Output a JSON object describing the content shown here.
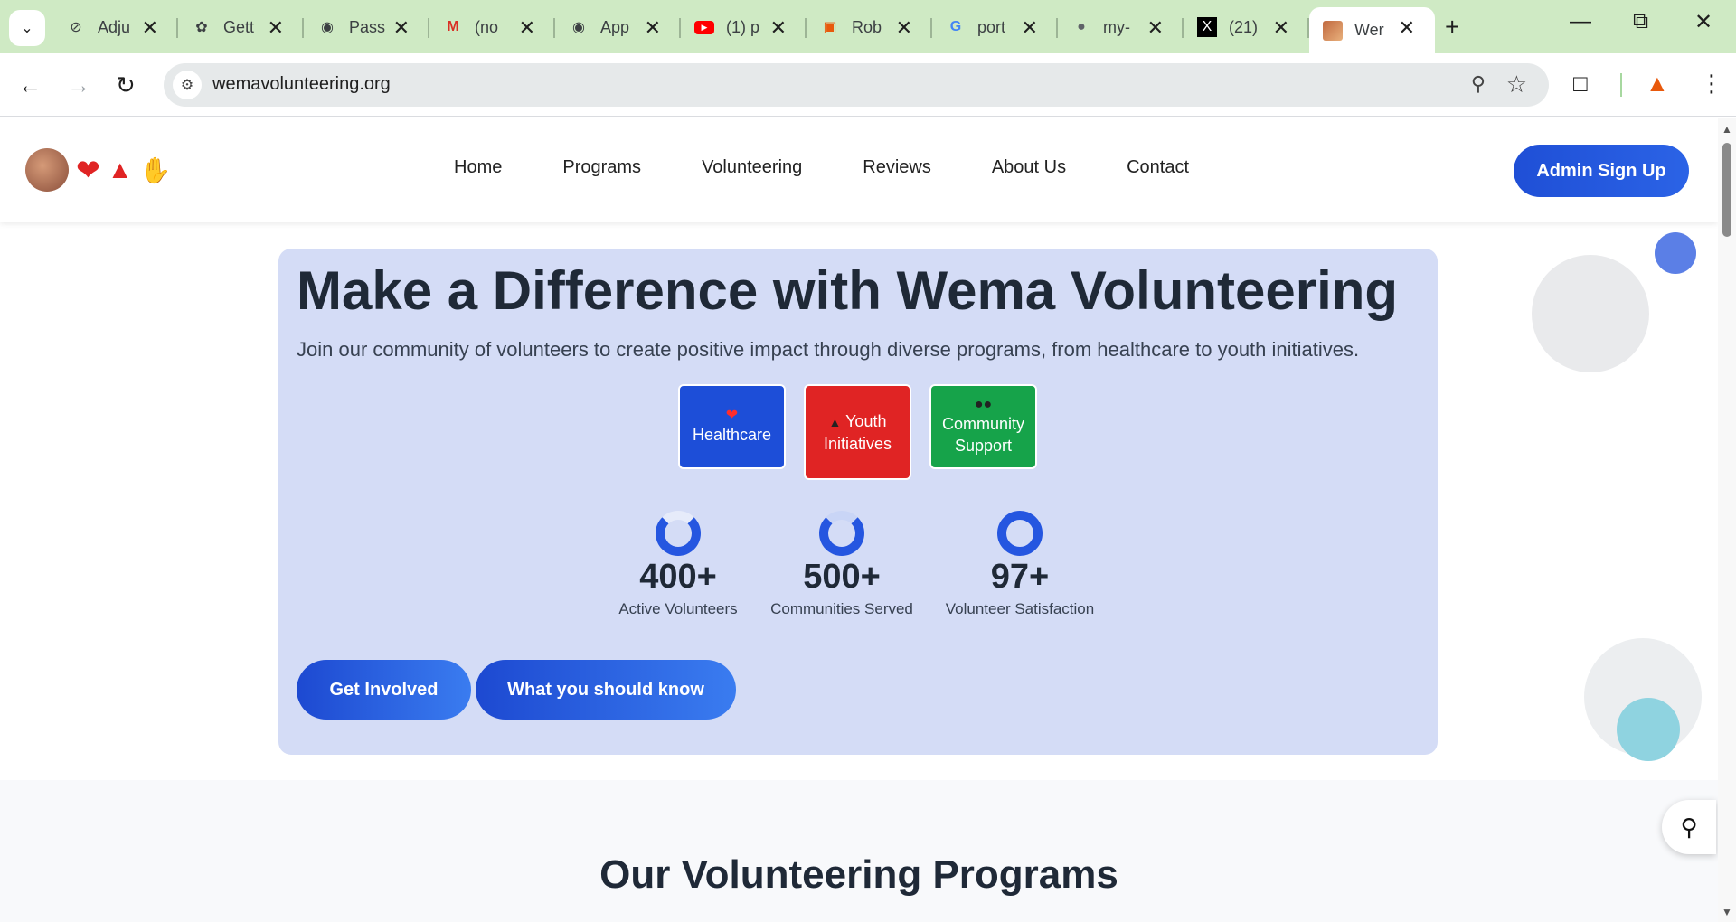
{
  "browser": {
    "tabs": [
      {
        "title": "Adju",
        "icon": "perplexity-icon"
      },
      {
        "title": "Gett",
        "icon": "openai-icon"
      },
      {
        "title": "Pass",
        "icon": "github-icon"
      },
      {
        "title": "(no",
        "icon": "gmail-icon"
      },
      {
        "title": "App",
        "icon": "github-icon"
      },
      {
        "title": "(1) p",
        "icon": "youtube-icon"
      },
      {
        "title": "Rob",
        "icon": "roblox-icon"
      },
      {
        "title": "port",
        "icon": "google-icon"
      },
      {
        "title": "my-",
        "icon": "globe-icon"
      },
      {
        "title": "(21)",
        "icon": "x-icon"
      },
      {
        "title": "Wer",
        "icon": "site-favicon"
      }
    ],
    "url": "wemavolunteering.org"
  },
  "site": {
    "nav": [
      "Home",
      "Programs",
      "Volunteering",
      "Reviews",
      "About Us",
      "Contact"
    ],
    "admin_button": "Admin Sign Up",
    "hero": {
      "title": "Make a Difference with Wema Volunteering",
      "subtitle": "Join our community of volunteers to create positive impact through diverse programs, from healthcare to youth initiatives.",
      "cards": [
        {
          "label": "Healthcare",
          "icon": "heart-icon",
          "color": "#1d4ed8"
        },
        {
          "label": "Youth Initiatives",
          "icon": "graduation-cap-icon",
          "color": "#e02424"
        },
        {
          "label": "Community Support",
          "icon": "people-icon",
          "color": "#16a34a"
        }
      ],
      "stats": [
        {
          "value": "400+",
          "label": "Active Volunteers"
        },
        {
          "value": "500+",
          "label": "Communities Served"
        },
        {
          "value": "97+",
          "label": "Volunteer Satisfaction"
        }
      ],
      "buttons": [
        "Get Involved",
        "What you should know"
      ]
    },
    "section_title": "Our Volunteering Programs"
  },
  "colors": {
    "tabstrip": "#cfeac4",
    "hero_bg": "#d4dcf6",
    "primary": "#1d4ed8",
    "accent_red": "#e02424",
    "accent_green": "#16a34a"
  }
}
